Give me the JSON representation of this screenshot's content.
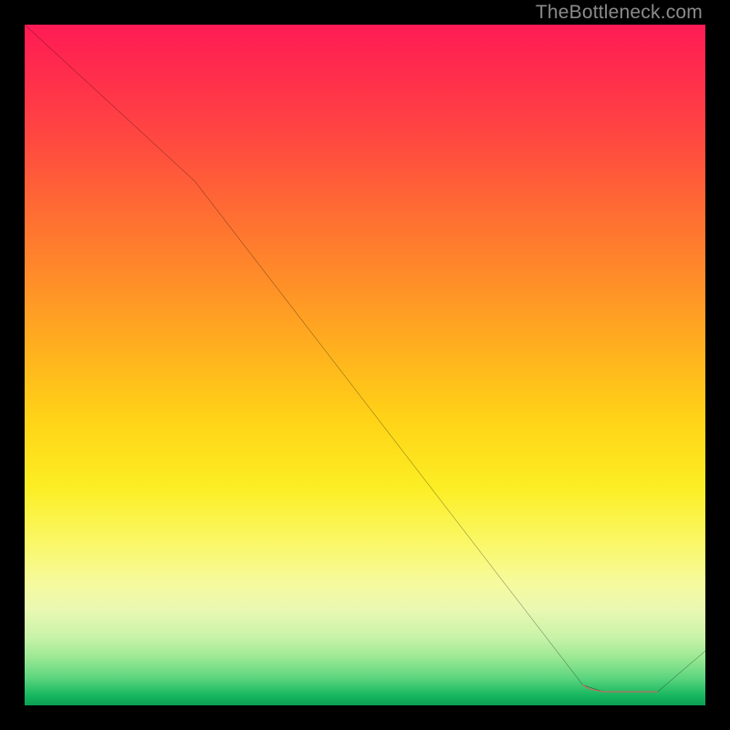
{
  "watermark": "TheBottleneck.com",
  "chart_data": {
    "type": "line",
    "title": "",
    "xlabel": "",
    "ylabel": "",
    "xlim": [
      0,
      100
    ],
    "ylim": [
      0,
      100
    ],
    "series": [
      {
        "name": "main-curve",
        "color": "#000000",
        "x": [
          0,
          25,
          82,
          85,
          90,
          93,
          100
        ],
        "y": [
          100,
          77,
          3,
          2,
          2,
          2,
          8
        ]
      },
      {
        "name": "valley-highlight",
        "color": "#e06060",
        "x": [
          82,
          83,
          85,
          88,
          90,
          92,
          93
        ],
        "y": [
          3,
          2.4,
          2,
          2,
          2,
          2,
          2
        ]
      }
    ],
    "gradient_stops": [
      {
        "pos": 0.0,
        "color": "#ff1b55"
      },
      {
        "pos": 0.38,
        "color": "#ff8f28"
      },
      {
        "pos": 0.68,
        "color": "#fcee24"
      },
      {
        "pos": 0.93,
        "color": "#9be893"
      },
      {
        "pos": 1.0,
        "color": "#0aa052"
      }
    ]
  }
}
